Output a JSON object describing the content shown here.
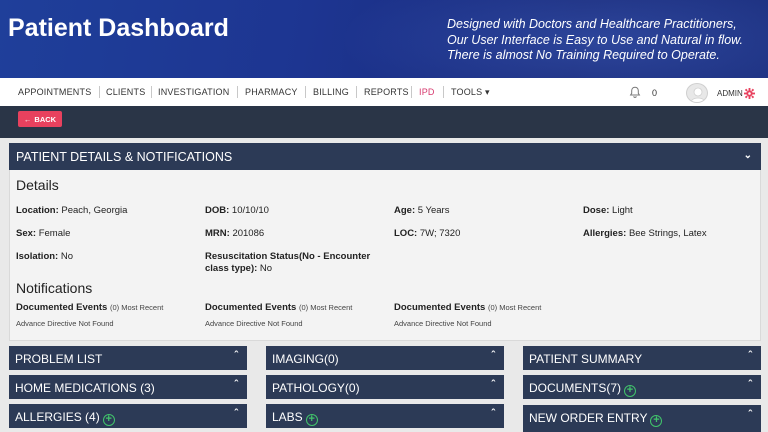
{
  "banner": {
    "title": "Patient Dashboard",
    "tagline": [
      "Designed with Doctors and Healthcare Practitioners,",
      "Our User Interface is Easy to Use and Natural in flow.",
      "There is almost No Training Required to Operate."
    ]
  },
  "nav": {
    "items": [
      "APPOINTMENTS",
      "CLIENTS",
      "INVESTIGATION",
      "PHARMACY",
      "BILLING",
      "REPORTS",
      "IPD",
      "TOOLS ▾"
    ],
    "active": "IPD",
    "notification_count": "0",
    "user_label": "ADMIN"
  },
  "back_button": {
    "label": "BACK"
  },
  "patient_panel": {
    "title": "PATIENT DETAILS & NOTIFICATIONS",
    "details_heading": "Details",
    "fields": [
      {
        "label": "Location:",
        "value": "Peach, Georgia"
      },
      {
        "label": "DOB:",
        "value": "10/10/10"
      },
      {
        "label": "Age:",
        "value": "5 Years"
      },
      {
        "label": "Dose:",
        "value": "Light"
      },
      {
        "label": "Sex:",
        "value": "Female"
      },
      {
        "label": "MRN:",
        "value": "201086"
      },
      {
        "label": "LOC:",
        "value": "7W; 7320"
      },
      {
        "label": "Allergies:",
        "value": "Bee Strings, Latex"
      },
      {
        "label": "Isolation:",
        "value": "No"
      },
      {
        "label": "Resuscitation Status(No - Encounter class type):",
        "value": "No"
      }
    ],
    "notifications_heading": "Notifications",
    "notifications": [
      {
        "label": "Documented Events",
        "meta": "(0) Most Recent",
        "sub": "Advance Directive Not Found"
      },
      {
        "label": "Documented Events",
        "meta": "(0) Most Recent",
        "sub": "Advance Directive Not Found"
      },
      {
        "label": "Documented Events",
        "meta": "(0) Most Recent",
        "sub": "Advance Directive Not Found"
      }
    ]
  },
  "widgets": [
    {
      "label": "PROBLEM LIST",
      "plus": false
    },
    {
      "label": "IMAGING(0)",
      "plus": false
    },
    {
      "label": "PATIENT SUMMARY",
      "plus": false
    },
    {
      "label": "HOME MEDICATIONS (3)",
      "plus": false
    },
    {
      "label": "PATHOLOGY(0)",
      "plus": false
    },
    {
      "label": "DOCUMENTS(7)",
      "plus": true
    },
    {
      "label": "ALLERGIES (4)",
      "plus": true
    },
    {
      "label": "LABS",
      "plus": true
    },
    {
      "label": "NEW ORDER ENTRY",
      "plus": true
    }
  ],
  "icons": {
    "bell": "bell-icon",
    "avatar": "user-avatar-icon",
    "gear": "gear-icon",
    "back_arrow": "arrow-left-icon",
    "chevron_down": "chevron-down-icon",
    "chevron_up": "chevron-up-icon",
    "plus": "plus-circle-icon"
  },
  "colors": {
    "banner": "#1d3591",
    "panel_header": "#2c3a56",
    "back_button": "#e8415e",
    "active_nav": "#d6386d",
    "plus_icon": "#41c46b"
  }
}
